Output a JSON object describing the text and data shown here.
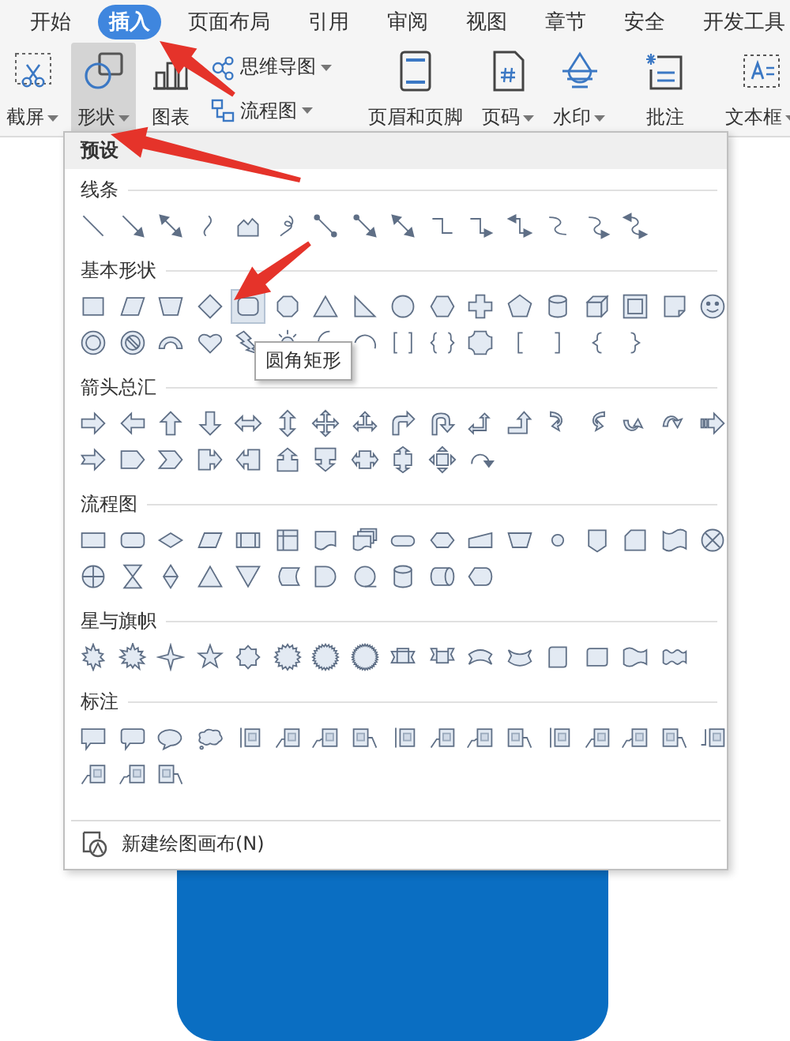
{
  "tabs": [
    {
      "label": "开始",
      "selected": false
    },
    {
      "label": "插入",
      "selected": true
    },
    {
      "label": "页面布局",
      "selected": false
    },
    {
      "label": "引用",
      "selected": false
    },
    {
      "label": "审阅",
      "selected": false
    },
    {
      "label": "视图",
      "selected": false
    },
    {
      "label": "章节",
      "selected": false
    },
    {
      "label": "安全",
      "selected": false
    },
    {
      "label": "开发工具",
      "selected": false
    }
  ],
  "ribbon": {
    "groups": [
      [
        {
          "kind": "screenshot",
          "label": "截屏",
          "dropdown": true,
          "selected": false
        },
        {
          "kind": "shapes",
          "label": "形状",
          "dropdown": true,
          "selected": true
        },
        {
          "kind": "chart",
          "label": "图表",
          "dropdown": false,
          "selected": false
        },
        {
          "kind": "stack",
          "items": [
            {
              "kind": "mind-map",
              "label": "思维导图",
              "dropdown": true,
              "selected": false
            },
            {
              "kind": "flowchart",
              "label": "流程图",
              "dropdown": true,
              "selected": false
            }
          ]
        }
      ],
      [
        {
          "kind": "header-footer",
          "label": "页眉和页脚",
          "dropdown": false,
          "selected": false
        },
        {
          "kind": "page-number",
          "label": "页码",
          "dropdown": true,
          "selected": false
        },
        {
          "kind": "watermark",
          "label": "水印",
          "dropdown": true,
          "selected": false
        }
      ],
      [
        {
          "kind": "comment",
          "label": "批注",
          "dropdown": false,
          "selected": false
        }
      ],
      [
        {
          "kind": "text-box",
          "label": "文本框",
          "dropdown": true,
          "selected": false
        }
      ]
    ]
  },
  "dropdown": {
    "header": "预设",
    "tooltip": "圆角矩形",
    "footer": "新建绘图画布(N)",
    "sections": [
      {
        "title": "线条",
        "rows": [
          [
            {
              "kind": "line",
              "hovered": false
            },
            {
              "kind": "arrow",
              "hovered": false
            },
            {
              "kind": "double-arrow",
              "hovered": false
            },
            {
              "kind": "curve",
              "hovered": false
            },
            {
              "kind": "freeform",
              "hovered": false
            },
            {
              "kind": "scribble",
              "hovered": false
            },
            {
              "kind": "connector",
              "hovered": false
            },
            {
              "kind": "connector-arrow",
              "hovered": false
            },
            {
              "kind": "connector-double-arrow",
              "hovered": false
            },
            {
              "kind": "elbow",
              "hovered": false
            },
            {
              "kind": "elbow-arrow",
              "hovered": false
            },
            {
              "kind": "elbow-double-arrow",
              "hovered": false
            },
            {
              "kind": "curved-connector",
              "hovered": false
            },
            {
              "kind": "curved-connector-arrow",
              "hovered": false
            },
            {
              "kind": "curved-connector-double-arrow",
              "hovered": false
            }
          ]
        ]
      },
      {
        "title": "基本形状",
        "rows": [
          [
            {
              "kind": "rectangle",
              "hovered": false
            },
            {
              "kind": "parallelogram",
              "hovered": false
            },
            {
              "kind": "trapezoid",
              "hovered": false
            },
            {
              "kind": "diamond",
              "hovered": false
            },
            {
              "kind": "rounded-rectangle",
              "hovered": true
            },
            {
              "kind": "octagon",
              "hovered": false
            },
            {
              "kind": "triangle",
              "hovered": false
            },
            {
              "kind": "right-triangle",
              "hovered": false
            },
            {
              "kind": "circle",
              "hovered": false
            },
            {
              "kind": "hexagon",
              "hovered": false
            },
            {
              "kind": "cross",
              "hovered": false
            },
            {
              "kind": "pentagon",
              "hovered": false
            },
            {
              "kind": "can",
              "hovered": false
            },
            {
              "kind": "cube",
              "hovered": false
            },
            {
              "kind": "bevel",
              "hovered": false
            },
            {
              "kind": "folded-corner",
              "hovered": false
            },
            {
              "kind": "smiley",
              "hovered": false
            }
          ],
          [
            {
              "kind": "donut",
              "hovered": false
            },
            {
              "kind": "no-symbol",
              "hovered": false
            },
            {
              "kind": "block-arc",
              "hovered": false
            },
            {
              "kind": "heart",
              "hovered": false
            },
            {
              "kind": "lightning",
              "hovered": false
            },
            {
              "kind": "sun",
              "hovered": false
            },
            {
              "kind": "moon",
              "hovered": false
            },
            {
              "kind": "arc",
              "hovered": false
            },
            {
              "kind": "bracket-pair",
              "hovered": false
            },
            {
              "kind": "brace-pair",
              "hovered": false
            },
            {
              "kind": "plaque",
              "hovered": false
            },
            {
              "kind": "left-bracket",
              "hovered": false
            },
            {
              "kind": "right-bracket",
              "hovered": false
            },
            {
              "kind": "left-brace",
              "hovered": false
            },
            {
              "kind": "right-brace",
              "hovered": false
            }
          ]
        ]
      },
      {
        "title": "箭头总汇",
        "rows": [
          [
            {
              "kind": "right-arrow",
              "hovered": false
            },
            {
              "kind": "left-arrow",
              "hovered": false
            },
            {
              "kind": "up-arrow",
              "hovered": false
            },
            {
              "kind": "down-arrow",
              "hovered": false
            },
            {
              "kind": "left-right-arrow",
              "hovered": false
            },
            {
              "kind": "up-down-arrow",
              "hovered": false
            },
            {
              "kind": "quad-arrow",
              "hovered": false
            },
            {
              "kind": "left-right-up-arrow",
              "hovered": false
            },
            {
              "kind": "bent-arrow",
              "hovered": false
            },
            {
              "kind": "u-turn-arrow",
              "hovered": false
            },
            {
              "kind": "left-up-arrow",
              "hovered": false
            },
            {
              "kind": "bent-up-arrow",
              "hovered": false
            },
            {
              "kind": "curved-right-arrow",
              "hovered": false
            },
            {
              "kind": "curved-left-arrow",
              "hovered": false
            },
            {
              "kind": "curved-up-arrow",
              "hovered": false
            },
            {
              "kind": "curved-down-arrow",
              "hovered": false
            },
            {
              "kind": "striped-right-arrow",
              "hovered": false
            }
          ],
          [
            {
              "kind": "notched-right-arrow",
              "hovered": false
            },
            {
              "kind": "pentagon-arrow",
              "hovered": false
            },
            {
              "kind": "chevron",
              "hovered": false
            },
            {
              "kind": "right-arrow-callout",
              "hovered": false
            },
            {
              "kind": "left-arrow-callout",
              "hovered": false
            },
            {
              "kind": "up-arrow-callout",
              "hovered": false
            },
            {
              "kind": "down-arrow-callout",
              "hovered": false
            },
            {
              "kind": "left-right-arrow-callout",
              "hovered": false
            },
            {
              "kind": "up-down-arrow-callout",
              "hovered": false
            },
            {
              "kind": "quad-arrow-callout",
              "hovered": false
            },
            {
              "kind": "circular-arrow",
              "hovered": false
            }
          ]
        ]
      },
      {
        "title": "流程图",
        "rows": [
          [
            {
              "kind": "wide-rectangle",
              "hovered": false
            },
            {
              "kind": "wide-rounded-rectangle",
              "hovered": false
            },
            {
              "kind": "wide-diamond",
              "hovered": false
            },
            {
              "kind": "wide-parallelogram",
              "hovered": false
            },
            {
              "kind": "predefined-process",
              "hovered": false
            },
            {
              "kind": "internal-storage",
              "hovered": false
            },
            {
              "kind": "document",
              "hovered": false
            },
            {
              "kind": "multidocument",
              "hovered": false
            },
            {
              "kind": "terminator",
              "hovered": false
            },
            {
              "kind": "wide-hexagon",
              "hovered": false
            },
            {
              "kind": "manual-input",
              "hovered": false
            },
            {
              "kind": "manual-operation",
              "hovered": false
            },
            {
              "kind": "small-circle",
              "hovered": false
            },
            {
              "kind": "offpage-connector",
              "hovered": false
            },
            {
              "kind": "card",
              "hovered": false
            },
            {
              "kind": "punched-tape",
              "hovered": false
            },
            {
              "kind": "circle-x",
              "hovered": false
            }
          ],
          [
            {
              "kind": "circle-plus",
              "hovered": false
            },
            {
              "kind": "hourglass",
              "hovered": false
            },
            {
              "kind": "sort",
              "hovered": false
            },
            {
              "kind": "triangle",
              "hovered": false
            },
            {
              "kind": "inverted-triangle",
              "hovered": false
            },
            {
              "kind": "stored-data",
              "hovered": false
            },
            {
              "kind": "delay",
              "hovered": false
            },
            {
              "kind": "sequential-access",
              "hovered": false
            },
            {
              "kind": "can",
              "hovered": false
            },
            {
              "kind": "direct-access",
              "hovered": false
            },
            {
              "kind": "display",
              "hovered": false
            }
          ]
        ]
      },
      {
        "title": "星与旗帜",
        "rows": [
          [
            {
              "kind": "explosion",
              "hovered": false
            },
            {
              "kind": "explosion-large",
              "hovered": false
            },
            {
              "kind": "star-4",
              "hovered": false
            },
            {
              "kind": "star-5",
              "hovered": false
            },
            {
              "kind": "star-8",
              "hovered": false
            },
            {
              "kind": "star-16",
              "hovered": false
            },
            {
              "kind": "star-24",
              "hovered": false
            },
            {
              "kind": "star-32",
              "hovered": false
            },
            {
              "kind": "ribbon-down",
              "hovered": false
            },
            {
              "kind": "ribbon-up",
              "hovered": false
            },
            {
              "kind": "curved-ribbon-down",
              "hovered": false
            },
            {
              "kind": "curved-ribbon-up",
              "hovered": false
            },
            {
              "kind": "vertical-scroll",
              "hovered": false
            },
            {
              "kind": "horizontal-scroll",
              "hovered": false
            },
            {
              "kind": "wave",
              "hovered": false
            },
            {
              "kind": "double-wave",
              "hovered": false
            }
          ]
        ]
      },
      {
        "title": "标注",
        "rows": [
          [
            {
              "kind": "rectangle-callout",
              "hovered": false
            },
            {
              "kind": "rounded-rectangle-callout",
              "hovered": false
            },
            {
              "kind": "oval-callout",
              "hovered": false
            },
            {
              "kind": "cloud-callout",
              "hovered": false
            },
            {
              "kind": "line-callout",
              "hovered": false
            },
            {
              "kind": "bent-line-callout",
              "hovered": false
            },
            {
              "kind": "double-bent-line-callout",
              "hovered": false
            },
            {
              "kind": "line-callout-right",
              "hovered": false
            },
            {
              "kind": "line-callout",
              "hovered": false
            },
            {
              "kind": "bent-line-callout",
              "hovered": false
            },
            {
              "kind": "double-bent-line-callout",
              "hovered": false
            },
            {
              "kind": "line-callout-right",
              "hovered": false
            },
            {
              "kind": "line-callout",
              "hovered": false
            },
            {
              "kind": "bent-line-callout",
              "hovered": false
            },
            {
              "kind": "double-bent-line-callout",
              "hovered": false
            },
            {
              "kind": "line-callout-right",
              "hovered": false
            },
            {
              "kind": "bar-callout",
              "hovered": false
            }
          ],
          [
            {
              "kind": "bent-line-callout",
              "hovered": false
            },
            {
              "kind": "double-bent-line-callout",
              "hovered": false
            },
            {
              "kind": "line-callout-right",
              "hovered": false
            }
          ]
        ]
      }
    ]
  }
}
